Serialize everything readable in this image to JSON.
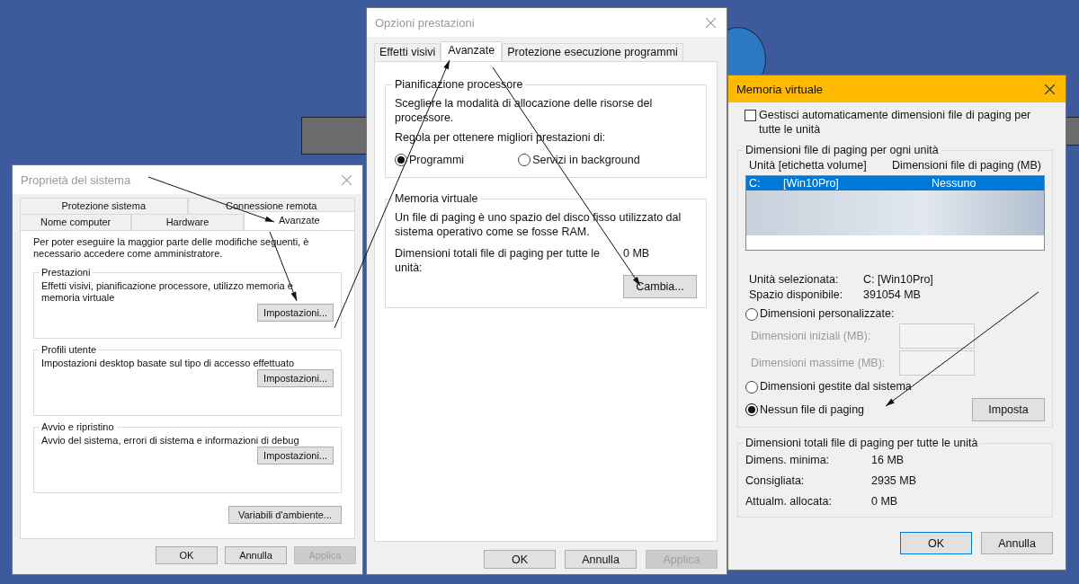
{
  "system_properties": {
    "title": "Proprietà del sistema",
    "tab_rows": [
      [
        {
          "label": "Protezione sistema",
          "selected": false
        },
        {
          "label": "Connessione remota",
          "selected": false
        }
      ],
      [
        {
          "label": "Nome computer",
          "selected": false
        },
        {
          "label": "Hardware",
          "selected": false
        },
        {
          "label": "Avanzate",
          "selected": true
        }
      ]
    ],
    "intro": "Per poter eseguire la maggior parte delle modifiche seguenti, è necessario accedere come amministratore.",
    "groups": [
      {
        "title": "Prestazioni",
        "text": "Effetti visivi, pianificazione processore, utilizzo memoria e memoria virtuale",
        "button": "Impostazioni..."
      },
      {
        "title": "Profili utente",
        "text": "Impostazioni desktop basate sul tipo di accesso effettuato",
        "button": "Impostazioni..."
      },
      {
        "title": "Avvio e ripristino",
        "text": "Avvio del sistema, errori di sistema e informazioni di debug",
        "button": "Impostazioni..."
      }
    ],
    "env_button": "Variabili d'ambiente...",
    "buttons": [
      {
        "label": "OK",
        "disabled": false
      },
      {
        "label": "Annulla",
        "disabled": false
      },
      {
        "label": "Applica",
        "disabled": true
      }
    ]
  },
  "performance_options": {
    "title": "Opzioni prestazioni",
    "tabs": [
      {
        "label": "Effetti visivi",
        "selected": false
      },
      {
        "label": "Avanzate",
        "selected": true
      },
      {
        "label": "Protezione esecuzione programmi",
        "selected": false
      }
    ],
    "scheduling": {
      "title": "Pianificazione processore",
      "text": "Scegliere la modalità di allocazione delle risorse del processore.",
      "prompt": "Regola per ottenere migliori prestazioni di:",
      "options": [
        {
          "label": "Programmi",
          "selected": true
        },
        {
          "label": "Servizi in background",
          "selected": false
        }
      ]
    },
    "virtual_memory": {
      "title": "Memoria virtuale",
      "text": "Un file di paging è uno spazio del disco fisso utilizzato dal sistema operativo come se fosse RAM.",
      "total_label": "Dimensioni totali file di paging per tutte le unità:",
      "total_value": "0 MB",
      "button": "Cambia..."
    },
    "buttons": [
      {
        "label": "OK",
        "disabled": false
      },
      {
        "label": "Annulla",
        "disabled": false
      },
      {
        "label": "Applica",
        "disabled": true
      }
    ]
  },
  "virtual_memory": {
    "title": "Memoria virtuale",
    "auto_manage": {
      "label": "Gestisci automaticamente dimensioni file di paging per tutte le unità",
      "checked": false
    },
    "drives_group": {
      "title": "Dimensioni file di paging per ogni unità",
      "columns": [
        "Unità [etichetta volume]",
        "Dimensioni file di paging (MB)"
      ],
      "rows": [
        {
          "drive": "C:",
          "label": "[Win10Pro]",
          "size": "Nessuno",
          "selected": true
        }
      ],
      "info": [
        {
          "label": "Unità selezionata:",
          "value": "C:  [Win10Pro]"
        },
        {
          "label": "Spazio disponibile:",
          "value": "391054 MB"
        }
      ],
      "options": [
        {
          "kind": "custom",
          "label": "Dimensioni personalizzate:",
          "selected": false
        },
        {
          "kind": "plain",
          "label": "Dimensioni gestite dal sistema",
          "selected": false
        },
        {
          "kind": "plain",
          "label": "Nessun file di paging",
          "selected": true
        }
      ],
      "fields": [
        {
          "label": "Dimensioni iniziali (MB):",
          "disabled": true
        },
        {
          "label": "Dimensioni massime (MB):",
          "disabled": true
        }
      ],
      "set_button": "Imposta"
    },
    "totals_group": {
      "title": "Dimensioni totali file di paging per tutte le unità",
      "rows": [
        {
          "label": "Dimens. minima:",
          "value": "16 MB"
        },
        {
          "label": "Consigliata:",
          "value": "2935 MB"
        },
        {
          "label": "Attualm. allocata:",
          "value": "0 MB"
        }
      ]
    },
    "buttons": [
      {
        "label": "OK",
        "default": true
      },
      {
        "label": "Annulla",
        "default": false
      }
    ]
  }
}
